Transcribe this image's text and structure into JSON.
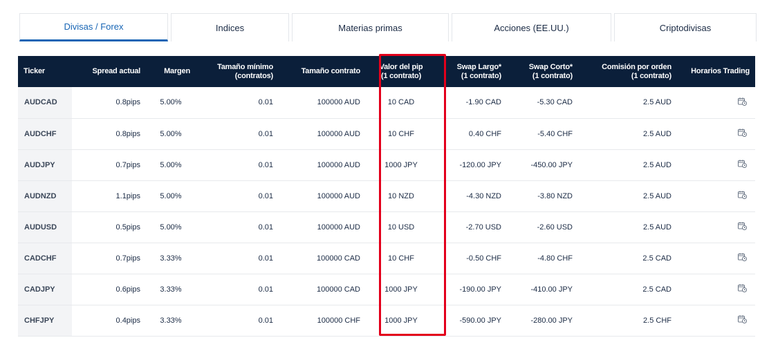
{
  "tabs": [
    {
      "label": "Divisas / Forex",
      "active": true
    },
    {
      "label": "Indices",
      "active": false
    },
    {
      "label": "Materias primas",
      "active": false
    },
    {
      "label": "Acciones (EE.UU.)",
      "active": false
    },
    {
      "label": "Criptodivisas",
      "active": false
    }
  ],
  "table": {
    "headers": {
      "ticker": "Ticker",
      "spread": "Spread actual",
      "margin": "Margen",
      "min_size_1": "Tamaño mínimo",
      "min_size_2": "(contratos)",
      "contract_size": "Tamaño contrato",
      "pip_value_1": "Valor del pip",
      "pip_value_2": "(1 contrato)",
      "swap_long_1": "Swap Largo*",
      "swap_long_2": "(1 contrato)",
      "swap_short_1": "Swap Corto*",
      "swap_short_2": "(1 contrato)",
      "commission_1": "Comisión por orden",
      "commission_2": "(1 contrato)",
      "hours": "Horarios Trading"
    },
    "rows": [
      {
        "ticker": "AUDCAD",
        "spread": "0.8pips",
        "margin": "5.00%",
        "min_size": "0.01",
        "contract_size": "100000 AUD",
        "pip_value": "10 CAD",
        "swap_long": "-1.90 CAD",
        "swap_short": "-5.30 CAD",
        "commission": "2.5 AUD",
        "hours_icon": "calendar-clock-icon"
      },
      {
        "ticker": "AUDCHF",
        "spread": "0.8pips",
        "margin": "5.00%",
        "min_size": "0.01",
        "contract_size": "100000 AUD",
        "pip_value": "10 CHF",
        "swap_long": "0.40 CHF",
        "swap_short": "-5.40 CHF",
        "commission": "2.5 AUD",
        "hours_icon": "calendar-clock-icon"
      },
      {
        "ticker": "AUDJPY",
        "spread": "0.7pips",
        "margin": "5.00%",
        "min_size": "0.01",
        "contract_size": "100000 AUD",
        "pip_value": "1000 JPY",
        "swap_long": "-120.00 JPY",
        "swap_short": "-450.00 JPY",
        "commission": "2.5 AUD",
        "hours_icon": "calendar-clock-icon"
      },
      {
        "ticker": "AUDNZD",
        "spread": "1.1pips",
        "margin": "5.00%",
        "min_size": "0.01",
        "contract_size": "100000 AUD",
        "pip_value": "10 NZD",
        "swap_long": "-4.30 NZD",
        "swap_short": "-3.80 NZD",
        "commission": "2.5 AUD",
        "hours_icon": "calendar-clock-icon"
      },
      {
        "ticker": "AUDUSD",
        "spread": "0.5pips",
        "margin": "5.00%",
        "min_size": "0.01",
        "contract_size": "100000 AUD",
        "pip_value": "10 USD",
        "swap_long": "-2.70 USD",
        "swap_short": "-2.60 USD",
        "commission": "2.5 AUD",
        "hours_icon": "calendar-clock-icon"
      },
      {
        "ticker": "CADCHF",
        "spread": "0.7pips",
        "margin": "3.33%",
        "min_size": "0.01",
        "contract_size": "100000 CAD",
        "pip_value": "10 CHF",
        "swap_long": "-0.50 CHF",
        "swap_short": "-4.80 CHF",
        "commission": "2.5 CAD",
        "hours_icon": "calendar-clock-icon"
      },
      {
        "ticker": "CADJPY",
        "spread": "0.6pips",
        "margin": "3.33%",
        "min_size": "0.01",
        "contract_size": "100000 CAD",
        "pip_value": "1000 JPY",
        "swap_long": "-190.00 JPY",
        "swap_short": "-410.00 JPY",
        "commission": "2.5 CAD",
        "hours_icon": "calendar-clock-icon"
      },
      {
        "ticker": "CHFJPY",
        "spread": "0.4pips",
        "margin": "3.33%",
        "min_size": "0.01",
        "contract_size": "100000 CHF",
        "pip_value": "1000 JPY",
        "swap_long": "-590.00 JPY",
        "swap_short": "-280.00 JPY",
        "commission": "2.5 CHF",
        "hours_icon": "calendar-clock-icon"
      }
    ]
  },
  "colors": {
    "header_bg": "#0b1f3a",
    "active_tab": "#1765b5",
    "highlight": "#e3001b"
  }
}
